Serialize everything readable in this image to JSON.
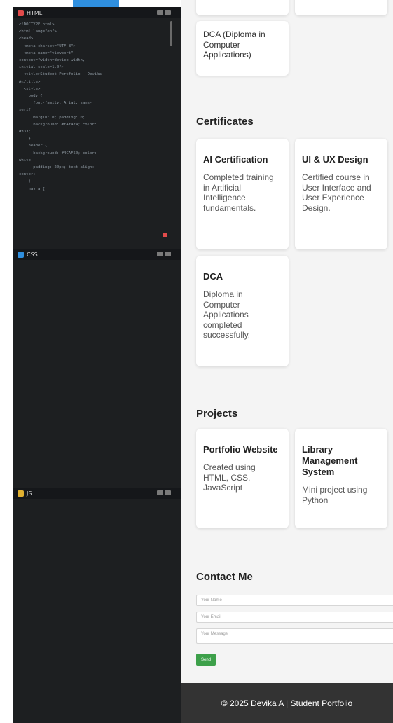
{
  "editor": {
    "html_panel": {
      "label": "HTML",
      "color": "#e24b4b"
    },
    "css_panel": {
      "label": "CSS",
      "color": "#2f8fdf"
    },
    "js_panel": {
      "label": "JS",
      "color": "#e0b030"
    },
    "html_code": [
      "<!DOCTYPE html>",
      "<html lang=\"en\">",
      "<head>",
      "  <meta charset=\"UTF-8\">",
      "  <meta name=\"viewport\"",
      "content=\"width=device-width,",
      "initial-scale=1.0\">",
      "  <title>Student Portfolio - Devika",
      "A</title>",
      "  <style>",
      "    body {",
      "      font-family: Arial, sans-",
      "serif;",
      "      margin: 0; padding: 0;",
      "      background: #f4f4f4; color:",
      "#333;",
      "    }",
      "    header {",
      "      background: #4CAF50; color:",
      "white;",
      "      padding: 20px; text-align:",
      "center;",
      "    }",
      "    nav a {"
    ]
  },
  "education": {
    "dca_card": "DCA (Diploma in Computer Applications)"
  },
  "certificates": {
    "title": "Certificates",
    "items": [
      {
        "title": "AI Certification",
        "desc": "Completed training in Artificial Intelligence fundamentals."
      },
      {
        "title": "UI & UX Design",
        "desc": "Certified course in User Interface and User Experience Design."
      },
      {
        "title": "DCA",
        "desc": "Diploma in Computer Applications completed successfully."
      }
    ]
  },
  "projects": {
    "title": "Projects",
    "items": [
      {
        "title": "Portfolio Website",
        "desc": "Created using HTML, CSS, JavaScript"
      },
      {
        "title": "Library Management System",
        "desc": "Mini project using Python"
      }
    ]
  },
  "contact": {
    "title": "Contact Me",
    "name_placeholder": "Your Name",
    "email_placeholder": "Your Email",
    "message_placeholder": "Your Message",
    "send_label": "Send"
  },
  "footer": {
    "text": "© 2025 Devika A | Student Portfolio"
  }
}
